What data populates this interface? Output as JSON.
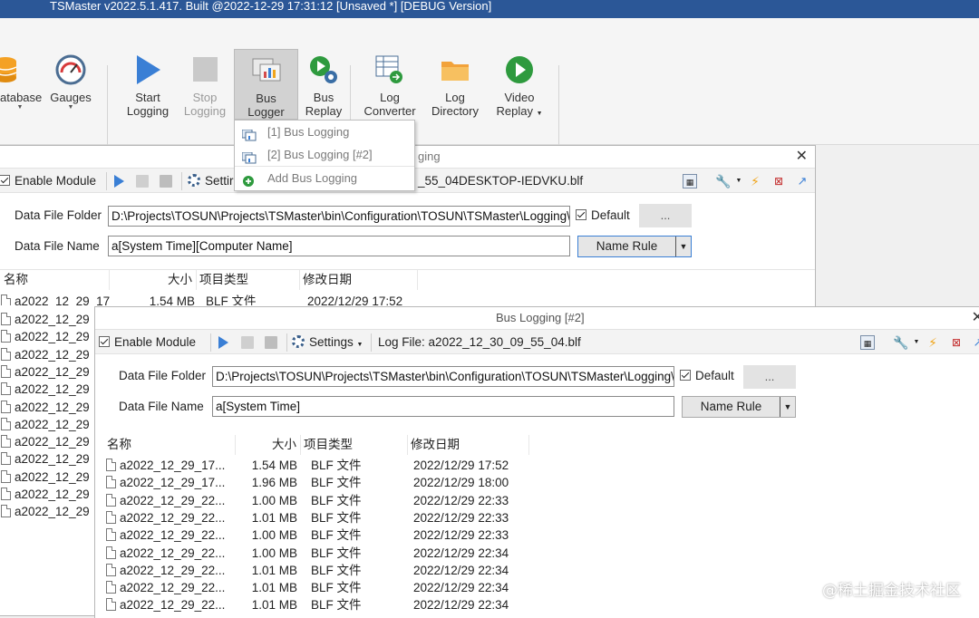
{
  "app": {
    "title": "TSMaster v2022.5.1.417. Built @2022-12-29 17:31:12 [Unsaved *] [DEBUG Version]"
  },
  "ribbon": {
    "buttons": [
      {
        "label": "atabase",
        "icon": "database-icon"
      },
      {
        "label": "Gauges",
        "icon": "gauge-icon"
      },
      {
        "label": "Start\nLogging",
        "icon": "play-icon"
      },
      {
        "label": "Stop\nLogging",
        "icon": "stop-icon"
      },
      {
        "label": "Bus\nLogger",
        "icon": "bus-logger-icon"
      },
      {
        "label": "Bus\nReplay",
        "icon": "replay-icon"
      },
      {
        "label": "Log\nConverter",
        "icon": "converter-icon"
      },
      {
        "label": "Log\nDirectory",
        "icon": "folder-icon"
      },
      {
        "label": "Video\nReplay",
        "icon": "video-icon"
      }
    ]
  },
  "bus_logger_menu": {
    "items": [
      "[1] Bus Logging",
      "[2] Bus Logging [#2]",
      "Add Bus Logging"
    ]
  },
  "window1": {
    "title": "ging",
    "enable_module": "Enable Module",
    "settings_label": "Settir",
    "log_file_text": "_55_04DESKTOP-IEDVKU.blf",
    "data_file_folder_label": "Data File Folder",
    "data_file_folder_value": "D:\\Projects\\TOSUN\\Projects\\TSMaster\\bin\\Configuration\\TOSUN\\TSMaster\\Logging\\E",
    "default_label": "Default",
    "browse_label": "...",
    "data_file_name_label": "Data File Name",
    "data_file_name_value": "a[System Time][Computer Name]",
    "name_rule_label": "Name Rule",
    "columns": [
      "名称",
      "大小",
      "项目类型",
      "修改日期"
    ],
    "first_row": {
      "name": "a2022_12_29_17",
      "size": "1.54 MB",
      "type": "BLF 文件",
      "date": "2022/12/29 17:52"
    },
    "rows": [
      "a2022_12_29",
      "a2022_12_29",
      "a2022_12_29",
      "a2022_12_29",
      "a2022_12_29",
      "a2022_12_29",
      "a2022_12_29",
      "a2022_12_29",
      "a2022_12_29",
      "a2022_12_29",
      "a2022_12_29",
      "a2022_12_29"
    ]
  },
  "window2": {
    "title": "Bus Logging [#2]",
    "enable_module": "Enable Module",
    "settings_label": "Settings",
    "log_file_label": "Log File:",
    "log_file_value": "a2022_12_30_09_55_04.blf",
    "data_file_folder_label": "Data File Folder",
    "data_file_folder_value": "D:\\Projects\\TOSUN\\Projects\\TSMaster\\bin\\Configuration\\TOSUN\\TSMaster\\Logging\\E",
    "default_label": "Default",
    "browse_label": "...",
    "data_file_name_label": "Data File Name",
    "data_file_name_value": "a[System Time]",
    "name_rule_label": "Name Rule",
    "columns": [
      "名称",
      "大小",
      "项目类型",
      "修改日期"
    ],
    "rows": [
      {
        "name": "a2022_12_29_17...",
        "size": "1.54 MB",
        "type": "BLF 文件",
        "date": "2022/12/29 17:52"
      },
      {
        "name": "a2022_12_29_17...",
        "size": "1.96 MB",
        "type": "BLF 文件",
        "date": "2022/12/29 18:00"
      },
      {
        "name": "a2022_12_29_22...",
        "size": "1.00 MB",
        "type": "BLF 文件",
        "date": "2022/12/29 22:33"
      },
      {
        "name": "a2022_12_29_22...",
        "size": "1.01 MB",
        "type": "BLF 文件",
        "date": "2022/12/29 22:33"
      },
      {
        "name": "a2022_12_29_22...",
        "size": "1.00 MB",
        "type": "BLF 文件",
        "date": "2022/12/29 22:33"
      },
      {
        "name": "a2022_12_29_22...",
        "size": "1.00 MB",
        "type": "BLF 文件",
        "date": "2022/12/29 22:34"
      },
      {
        "name": "a2022_12_29_22...",
        "size": "1.01 MB",
        "type": "BLF 文件",
        "date": "2022/12/29 22:34"
      },
      {
        "name": "a2022_12_29_22...",
        "size": "1.01 MB",
        "type": "BLF 文件",
        "date": "2022/12/29 22:34"
      },
      {
        "name": "a2022_12_29_22...",
        "size": "1.01 MB",
        "type": "BLF 文件",
        "date": "2022/12/29 22:34"
      }
    ]
  },
  "watermark": "@稀土掘金技术社区",
  "colors": {
    "titlebar": "#2b5797",
    "play": "#3a7fd5",
    "video": "#2e9a3e",
    "folder": "#f2a23a"
  }
}
